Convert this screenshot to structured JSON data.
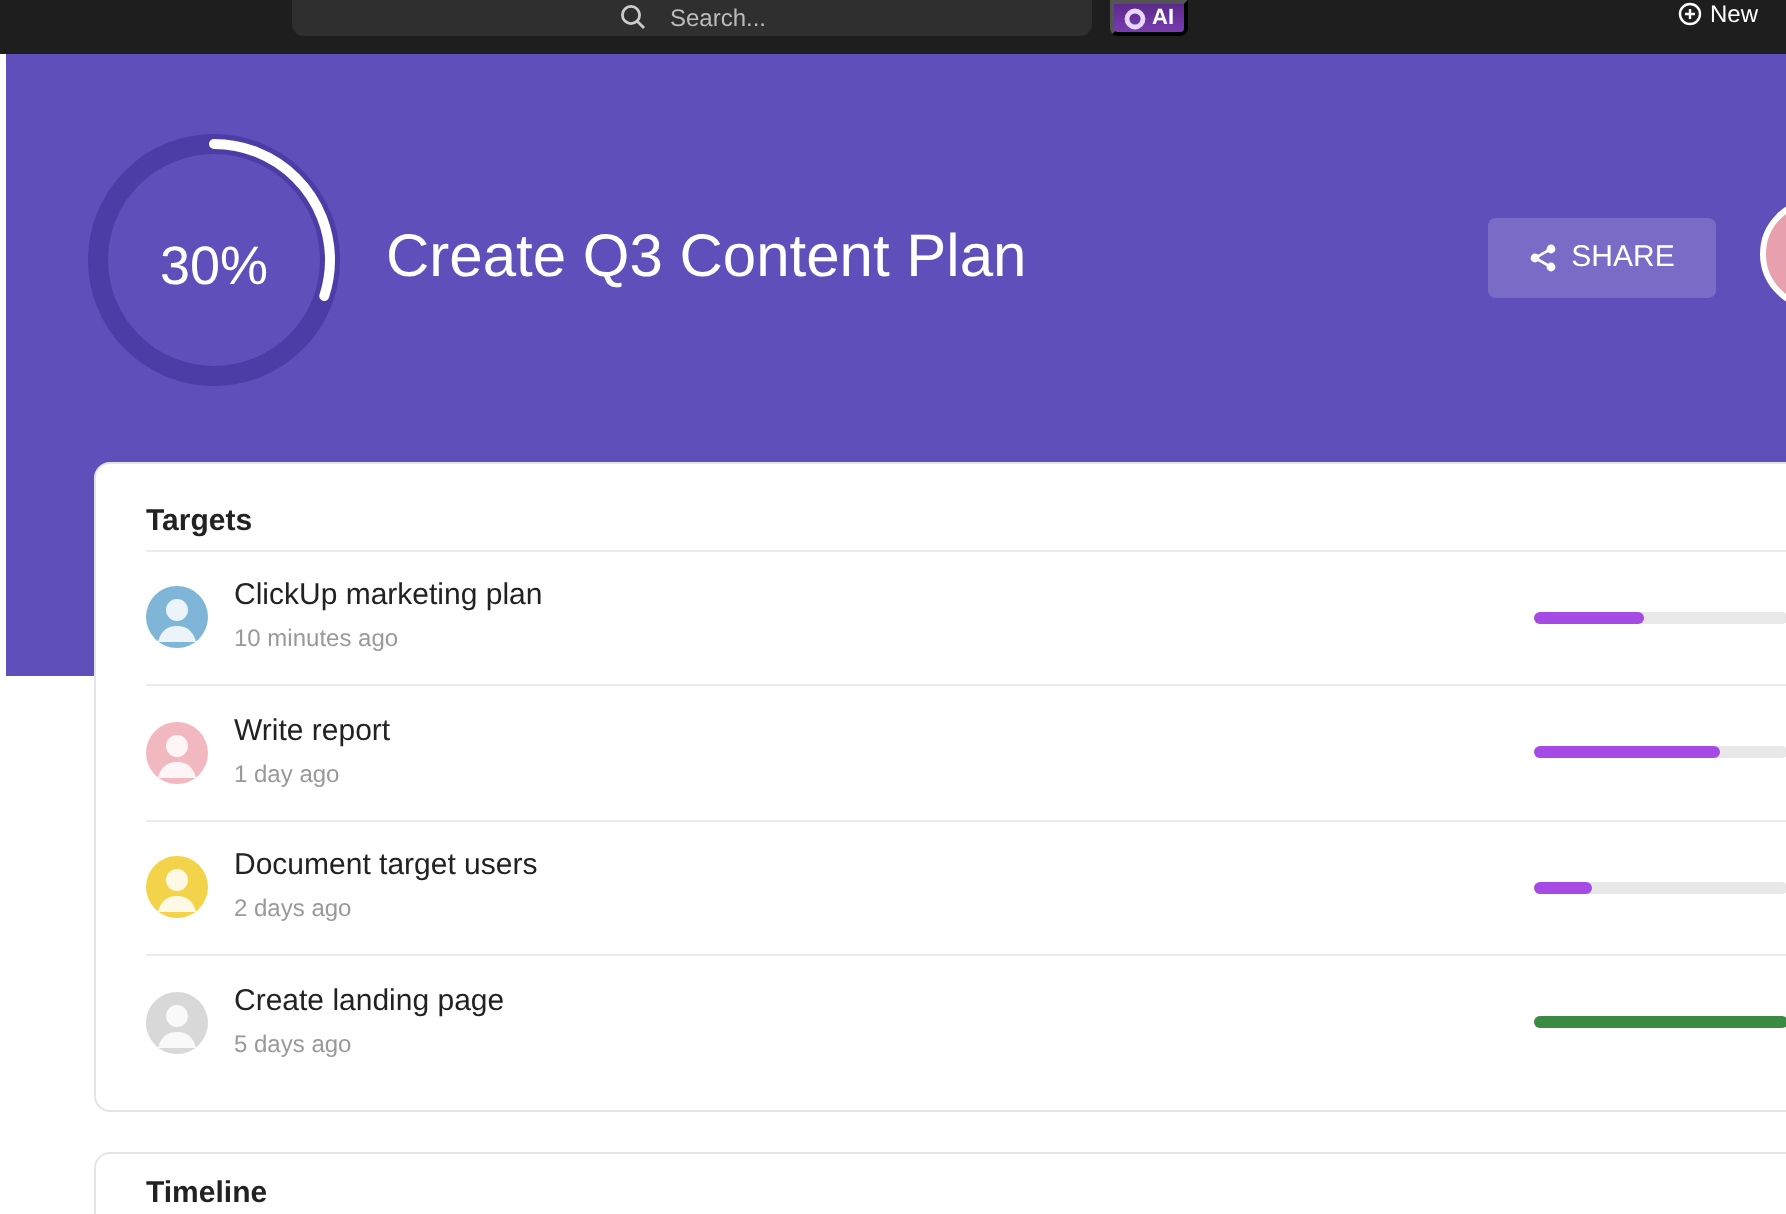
{
  "topbar": {
    "search": {
      "placeholder": "Search..."
    },
    "ai_label": "AI",
    "new_label": "New"
  },
  "header": {
    "progress": {
      "level": 0.3,
      "reading": "30%"
    },
    "title": "Create Q3 Content Plan",
    "share_label": "SHARE"
  },
  "targets": {
    "title": "Targets",
    "items": [
      {
        "name": "ClickUp marketing plan",
        "time": "10 minutes ago",
        "level": 0.43,
        "color": "#a64ae6"
      },
      {
        "name": "Write report",
        "time": "1 day ago",
        "level": 0.73,
        "color": "#a64ae6"
      },
      {
        "name": "Document target users",
        "time": "2 days ago",
        "level": 0.23,
        "color": "#a64ae6"
      },
      {
        "name": "Create landing page",
        "time": "5 days ago",
        "level": 1,
        "color": "#3a8a44"
      }
    ]
  },
  "timeline": {
    "title": "Timeline"
  }
}
